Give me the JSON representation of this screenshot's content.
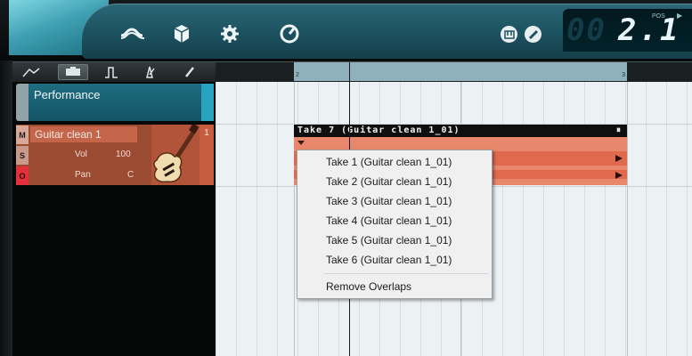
{
  "toolbar_top": {
    "icons": [
      "mixer-icon",
      "sound-bank-icon",
      "gear-icon",
      "tempo-icon"
    ],
    "round_buttons": [
      "metronome-icon",
      "no-entry-icon"
    ],
    "position_display": {
      "ghost": "00",
      "value": "2.1",
      "pos_label": "POS",
      "play_glyph": "▶"
    }
  },
  "tools": [
    "automation-tool-icon",
    "arrange-tool-icon",
    "step-tool-icon",
    "metronome-tool-icon",
    "pencil-tool-icon"
  ],
  "ruler": {
    "loop_start_marker": "2",
    "loop_end_marker": "3"
  },
  "performance_track": {
    "label": "Performance"
  },
  "track": {
    "buttons": [
      "M",
      "S",
      "O"
    ],
    "name": "Guitar clean 1",
    "vol_label": "Vol",
    "vol_value": "100",
    "pan_label": "Pan",
    "pan_value": "C",
    "number": "1"
  },
  "event": {
    "title": "Take 7 (Guitar clean 1_01)",
    "pause_glyph": "⏸"
  },
  "context_menu": {
    "takes": [
      "Take 1 (Guitar clean 1_01)",
      "Take 2 (Guitar clean 1_01)",
      "Take 3 (Guitar clean 1_01)",
      "Take 4 (Guitar clean 1_01)",
      "Take 5 (Guitar clean 1_01)",
      "Take 6 (Guitar clean 1_01)"
    ],
    "remove_overlaps": "Remove Overlaps"
  },
  "colors": {
    "accent_teal": "#1f6d80",
    "track_red": "#c4654a",
    "event_salmon": "#e8876b",
    "grid_bg": "#ecf1f3"
  }
}
